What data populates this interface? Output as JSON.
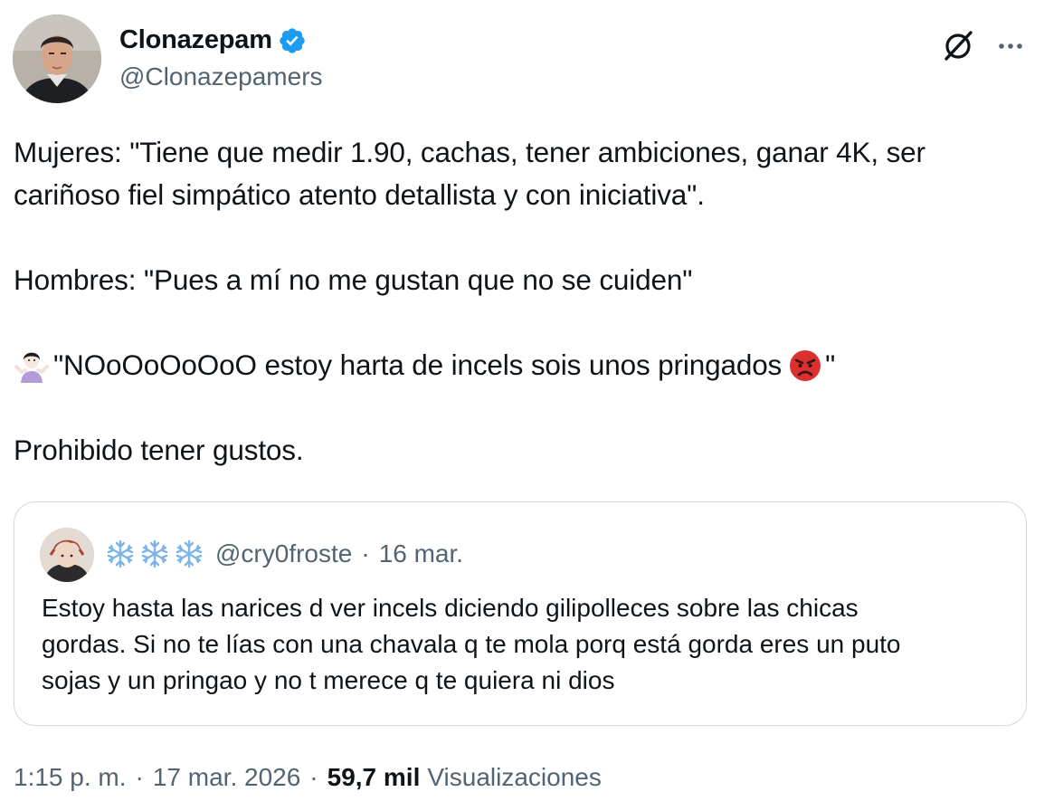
{
  "author": {
    "name": "Clonazepam",
    "handle": "@Clonazepamers",
    "verified": true,
    "verified_color": "#1d9bf0"
  },
  "tweet": {
    "line1": "Mujeres: \"Tiene que medir 1.90, cachas, tener ambiciones, ganar 4K, ser",
    "line2": "cariñoso fiel simpático atento detallista y con iniciativa\".",
    "line3": "Hombres: \"Pues a mí no me gustan que no se cuiden\"",
    "line4_text": "\"NOoOoOoOoO estoy harta de incels sois unos pringados",
    "line4_end": "\"",
    "line4_emoji_start": "woman-shrugging-emoji",
    "line4_emoji_end": "angry-face-emoji",
    "line5": "Prohibido tener gustos."
  },
  "quote": {
    "display_name_icons": [
      "snowflake-icon",
      "snowflake-icon",
      "snowflake-icon"
    ],
    "handle": "@cry0froste",
    "separator": "·",
    "date": "16 mar.",
    "line1": "Estoy hasta las narices d ver incels diciendo gilipolleces sobre las chicas",
    "line2": "gordas. Si no te lías con una chavala q te mola porq está gorda eres un puto",
    "line3": "sojas y un pringao y no t merece q te quiera ni dios"
  },
  "footer": {
    "time": "1:15 p. m.",
    "separator": "·",
    "date": "17 mar. 2026",
    "views_count": "59,7 mil",
    "views_label": "Visualizaciones"
  },
  "icons": {
    "grok": "grok-icon",
    "more": "more-icon"
  },
  "colors": {
    "text": "#0f1419",
    "secondary": "#536471",
    "border": "#cfd9de",
    "verified": "#1d9bf0"
  }
}
